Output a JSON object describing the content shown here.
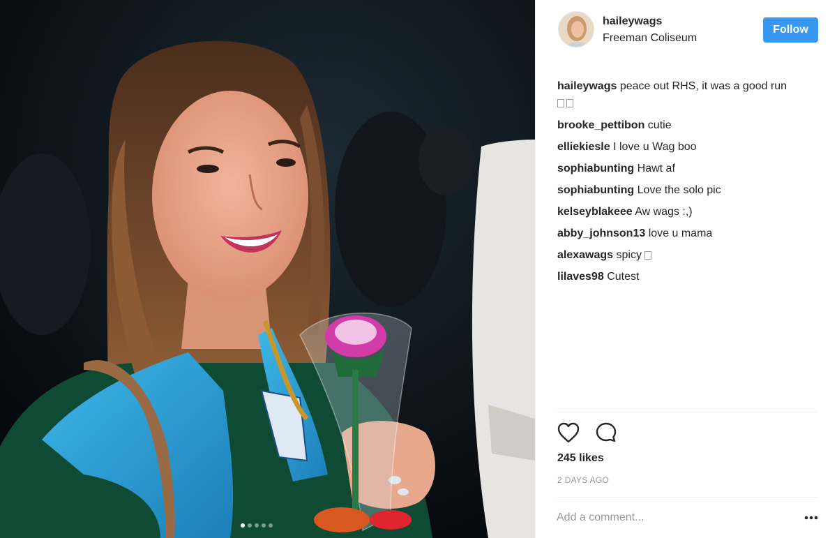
{
  "post": {
    "author": "haileywags",
    "location": "Freeman Coliseum",
    "follow_label": "Follow",
    "accent_color": "#3897f0",
    "carousel": {
      "count": 5,
      "active_index": 0
    },
    "comments": [
      {
        "user": "haileywags",
        "text": "peace out RHS, it was a good run"
      },
      {
        "user": "brooke_pettibon",
        "text": "cutie"
      },
      {
        "user": "elliekiesle",
        "text": "I love u Wag boo"
      },
      {
        "user": "sophiabunting",
        "text": "Hawt af"
      },
      {
        "user": "sophiabunting",
        "text": "Love the solo pic"
      },
      {
        "user": "kelseyblakeee",
        "text": "Aw wags :,)"
      },
      {
        "user": "abby_johnson13",
        "text": "love u mama"
      },
      {
        "user": "alexawags",
        "text": "spicy"
      },
      {
        "user": "lilaves98",
        "text": "Cutest"
      }
    ],
    "likes": "245 likes",
    "date": "2 DAYS AGO",
    "comment_placeholder": "Add a comment...",
    "icons": {
      "like": "heart-icon",
      "comment": "comment-bubble-icon",
      "more": "more-options-icon"
    }
  }
}
